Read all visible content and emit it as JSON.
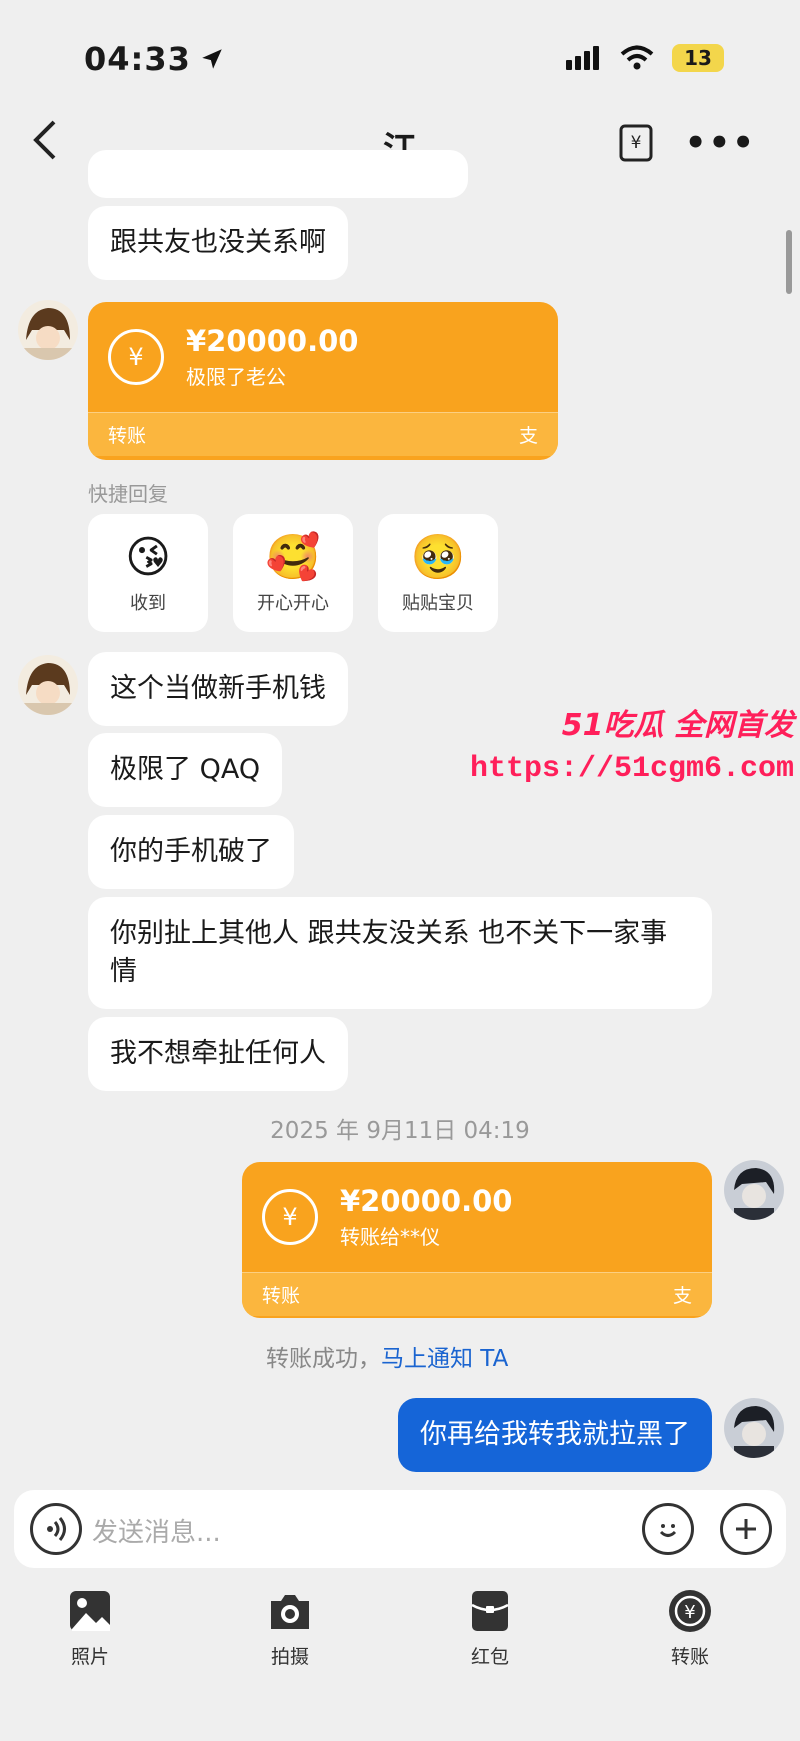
{
  "status": {
    "time": "04:33",
    "battery": "13"
  },
  "nav": {
    "title": "江"
  },
  "messages": {
    "m1": "跟共友也没关系啊",
    "m2": "这个当做新手机钱",
    "m3": "极限了 QAQ",
    "m4": "你的手机破了",
    "m5": "你别扯上其他人 跟共友没关系 也不关下一家事情",
    "m6": "我不想牵扯任何人",
    "me1": "你再给我转我就拉黑了"
  },
  "transfer_in": {
    "amount": "¥20000.00",
    "note": "极限了老公",
    "label": "转账",
    "brand": "支"
  },
  "transfer_out": {
    "amount": "¥20000.00",
    "note": "转账给**仪",
    "label": "转账",
    "brand": "支"
  },
  "quick_reply": {
    "label": "快捷回复",
    "items": [
      {
        "text": "收到",
        "emoji": "😘"
      },
      {
        "text": "开心开心",
        "emoji": "🥰"
      },
      {
        "text": "贴贴宝贝",
        "emoji": "🥹"
      }
    ]
  },
  "timestamp": "2025 年 9月11日 04:19",
  "success": {
    "text": "转账成功，",
    "link": "马上通知 TA"
  },
  "watermark": {
    "title": "51吃瓜 全网首发",
    "url": "https://51cgm6.com"
  },
  "input": {
    "placeholder": "发送消息..."
  },
  "toolbar": [
    {
      "label": "照片",
      "icon": "photo-icon"
    },
    {
      "label": "拍摄",
      "icon": "camera-icon"
    },
    {
      "label": "红包",
      "icon": "red-packet-icon"
    },
    {
      "label": "转账",
      "icon": "transfer-icon"
    }
  ]
}
